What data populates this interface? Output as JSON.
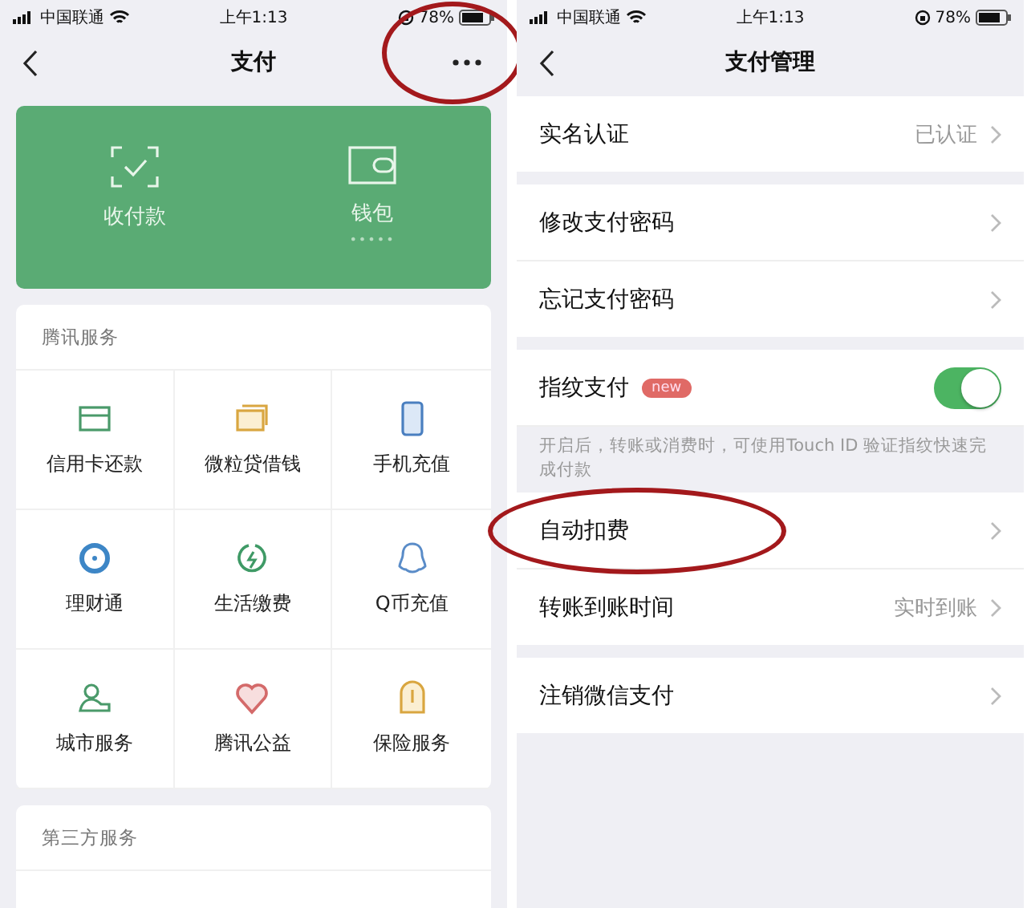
{
  "left_screen": {
    "status_bar": {
      "carrier": "中国联通",
      "time": "上午1:13",
      "battery": "78%"
    },
    "nav": {
      "title": "支付",
      "more_circled": true
    },
    "wallet_panel": [
      {
        "label": "收付款"
      },
      {
        "label": "钱包",
        "sub": "•••••"
      }
    ],
    "sections": [
      {
        "title": "腾讯服务",
        "items": [
          {
            "label": "信用卡还款"
          },
          {
            "label": "微粒贷借钱"
          },
          {
            "label": "手机充值"
          },
          {
            "label": "理财通"
          },
          {
            "label": "生活缴费"
          },
          {
            "label": "Q币充值"
          },
          {
            "label": "城市服务"
          },
          {
            "label": "腾讯公益"
          },
          {
            "label": "保险服务"
          }
        ]
      },
      {
        "title": "第三方服务"
      }
    ]
  },
  "right_screen": {
    "status_bar": {
      "carrier": "中国联通",
      "time": "上午1:13",
      "battery": "78%"
    },
    "nav": {
      "title": "支付管理"
    },
    "groups": [
      {
        "rows": [
          {
            "kind": "link",
            "label": "实名认证",
            "value": "已认证",
            "circled": false
          }
        ]
      },
      {
        "rows": [
          {
            "kind": "link",
            "label": "修改支付密码",
            "circled": false
          },
          {
            "kind": "link",
            "label": "忘记支付密码",
            "circled": false
          }
        ]
      },
      {
        "rows": [
          {
            "kind": "toggle",
            "label": "指纹支付",
            "badge": "new",
            "on": true
          },
          {
            "kind": "note",
            "text": "开启后，转账或消费时，可使用Touch ID 验证指纹快速完成付款"
          },
          {
            "kind": "link",
            "label": "自动扣费",
            "circled": true
          },
          {
            "kind": "link",
            "label": "转账到账时间",
            "value": "实时到账",
            "circled": false
          }
        ]
      },
      {
        "rows": [
          {
            "kind": "link",
            "label": "注销微信支付",
            "circled": false
          }
        ]
      }
    ]
  }
}
